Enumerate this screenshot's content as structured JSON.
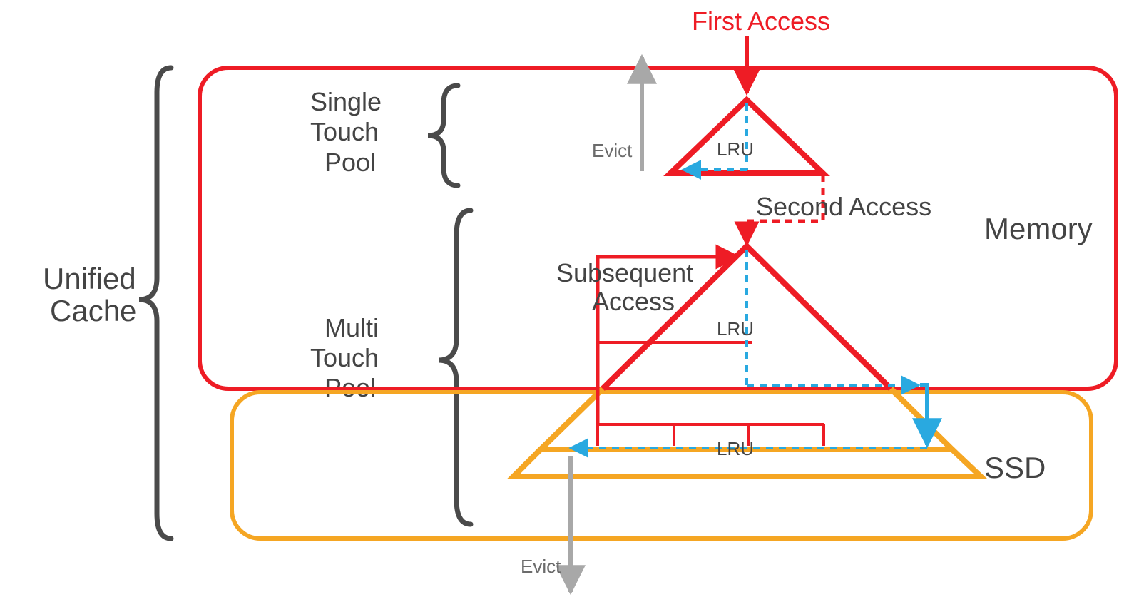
{
  "colors": {
    "gray": "#4a4a4a",
    "lightgray": "#a8a8a8",
    "red": "#ee1c25",
    "orange": "#f5a623",
    "cyan": "#29a9e0"
  },
  "labels": {
    "unified_cache_l1": "Unified",
    "unified_cache_l2": "Cache",
    "single_touch_l1": "Single",
    "single_touch_l2": "Touch",
    "single_touch_l3": "Pool",
    "multi_touch_l1": "Multi",
    "multi_touch_l2": "Touch",
    "multi_touch_l3": "Pool",
    "memory": "Memory",
    "ssd": "SSD",
    "first_access": "First Access",
    "second_access": "Second Access",
    "subsequent_l1": "Subsequent",
    "subsequent_l2": "Access",
    "evict_top": "Evict",
    "evict_bottom": "Evict",
    "lru_top": "LRU",
    "lru_mid": "LRU",
    "lru_bottom": "LRU"
  }
}
